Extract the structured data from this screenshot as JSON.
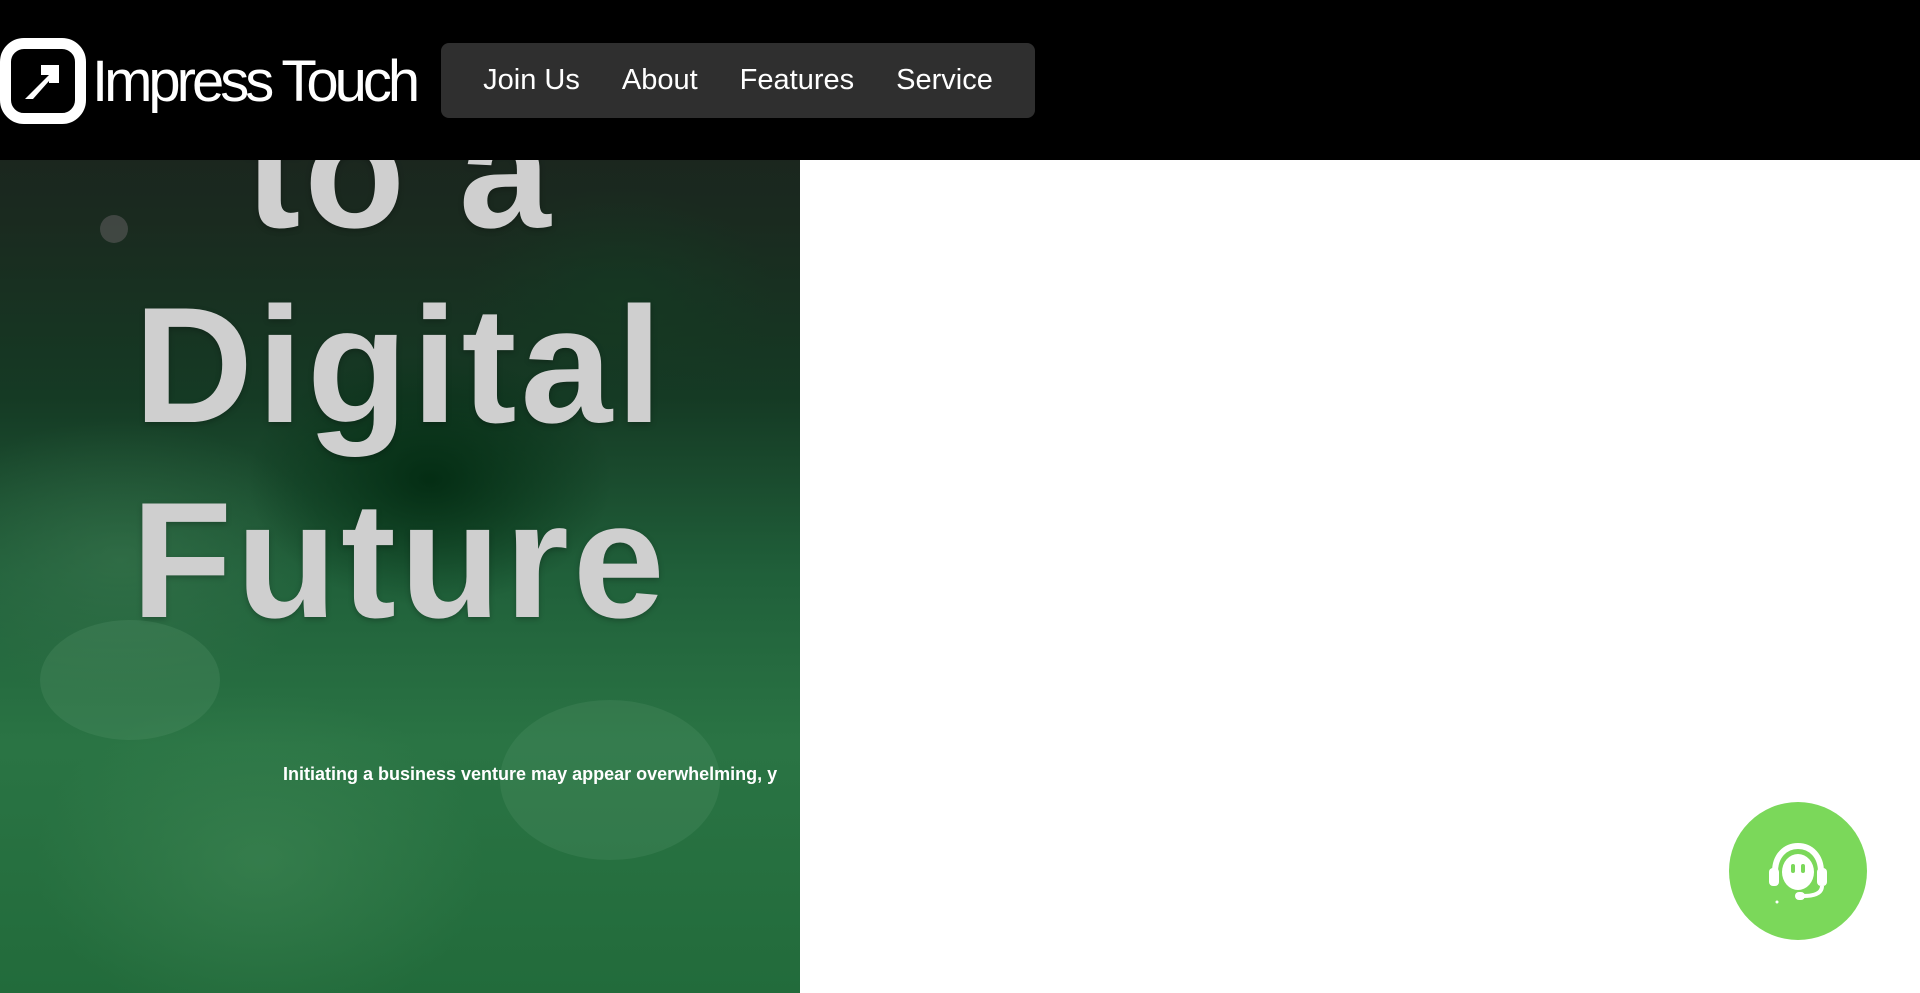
{
  "brand": {
    "name": "Impress Touch"
  },
  "nav": {
    "items": [
      {
        "label": "Join Us"
      },
      {
        "label": "About"
      },
      {
        "label": "Features"
      },
      {
        "label": "Service"
      }
    ]
  },
  "hero": {
    "headline_lines": [
      "to a",
      "Digital",
      "Future"
    ],
    "subtext": "Initiating a business venture may appear overwhelming, y"
  },
  "support_widget": {
    "icon": "headset-icon"
  },
  "colors": {
    "topbar": "#000000",
    "nav_background": "#2f2f2f",
    "support_button": "#7bd85a",
    "headline": "#cfcfcf"
  }
}
